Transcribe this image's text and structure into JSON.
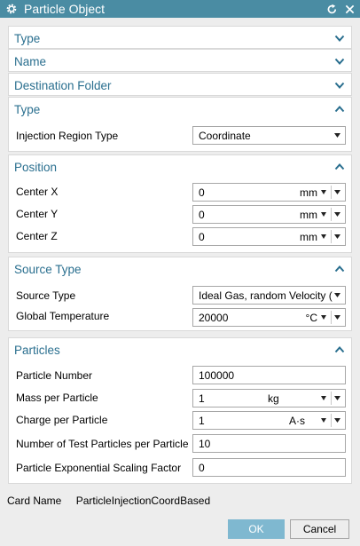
{
  "window": {
    "title": "Particle Object",
    "icons": [
      "gear-icon",
      "reset-icon",
      "close-icon"
    ],
    "accent": "#4a8ca3",
    "section_color": "#2a6f8f"
  },
  "collapsed_sections": [
    "Type",
    "Name",
    "Destination Folder"
  ],
  "type_section": {
    "title": "Type",
    "injection_region_label": "Injection Region Type",
    "injection_region_value": "Coordinate"
  },
  "position": {
    "title": "Position",
    "center_x_label": "Center X",
    "center_x_value": "0",
    "center_x_unit": "mm",
    "center_y_label": "Center Y",
    "center_y_value": "0",
    "center_y_unit": "mm",
    "center_z_label": "Center Z",
    "center_z_value": "0",
    "center_z_unit": "mm"
  },
  "source_type": {
    "title": "Source Type",
    "source_type_label": "Source Type",
    "source_type_value": "Ideal Gas, random Velocity (",
    "temp_label": "Global Temperature",
    "temp_value": "20000",
    "temp_unit": "°C"
  },
  "particles": {
    "title": "Particles",
    "number_label": "Particle Number",
    "number_value": "100000",
    "mass_label": "Mass per Particle",
    "mass_value": "1",
    "mass_unit": "kg",
    "charge_label": "Charge per Particle",
    "charge_value": "1",
    "charge_unit": "A·s",
    "test_label": "Number of Test Particles per Particle",
    "test_value": "10",
    "scaling_label": "Particle Exponential Scaling Factor",
    "scaling_value": "0"
  },
  "footer": {
    "card_name_label": "Card Name",
    "card_name_value": "ParticleInjectionCoordBased",
    "ok_label": "OK",
    "cancel_label": "Cancel"
  }
}
